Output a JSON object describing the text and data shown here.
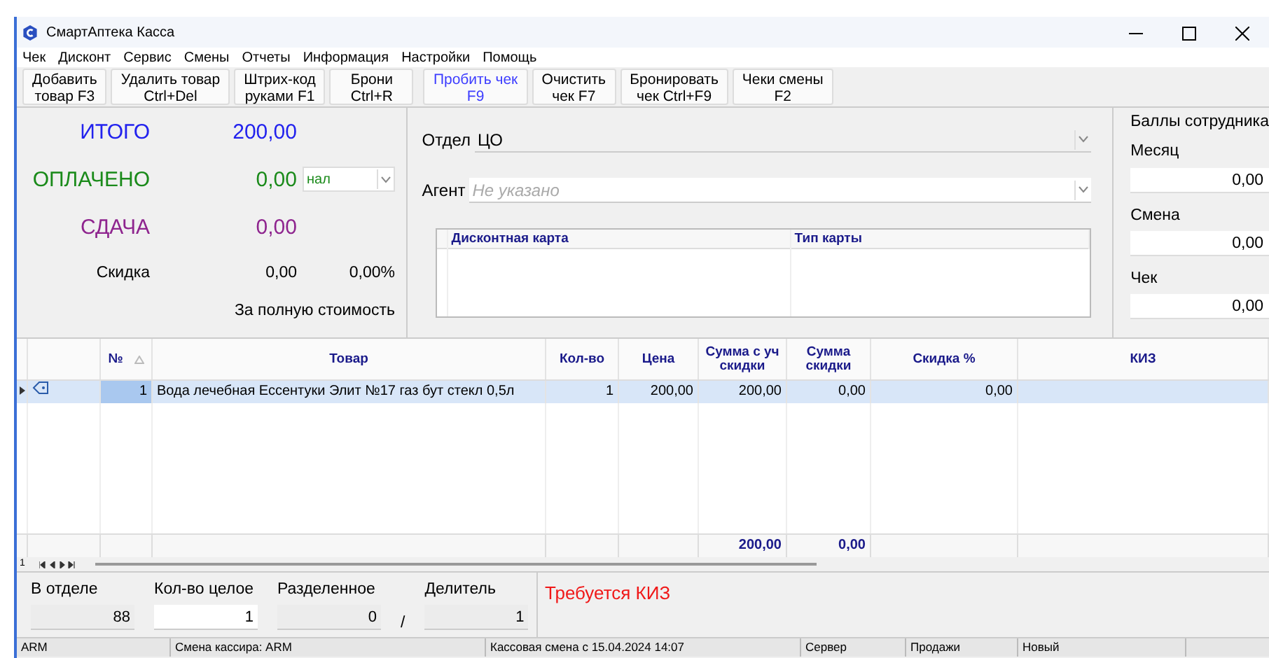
{
  "window": {
    "title": "СмартАптека Касса"
  },
  "menu": [
    "Чек",
    "Дисконт",
    "Сервис",
    "Смены",
    "Отчеты",
    "Информация",
    "Настройки",
    "Помощь"
  ],
  "toolbar": [
    {
      "lines": [
        "Добавить",
        "товар F3"
      ],
      "kind": "normal"
    },
    {
      "lines": [
        "Удалить товар",
        "Ctrl+Del"
      ],
      "kind": "normal"
    },
    {
      "lines": [
        "Штрих-код",
        "руками F1"
      ],
      "kind": "normal"
    },
    {
      "lines": [
        "Брони",
        "Ctrl+R"
      ],
      "kind": "normal"
    },
    {
      "lines": [
        "Пробить чек",
        "F9"
      ],
      "kind": "primary"
    },
    {
      "lines": [
        "Очистить",
        "чек F7"
      ],
      "kind": "normal"
    },
    {
      "lines": [
        "Бронировать",
        "чек Ctrl+F9"
      ],
      "kind": "normal"
    },
    {
      "lines": [
        "Чеки смены",
        "F2"
      ],
      "kind": "normal"
    }
  ],
  "summary": {
    "totals": [
      {
        "label": "ИТОГО",
        "value": "200,00",
        "kind": "total"
      },
      {
        "label": "ОПЛАЧЕНО",
        "value": "0,00",
        "kind": "paid",
        "payment": "нал"
      },
      {
        "label": "СДАЧА",
        "value": "0,00",
        "kind": "change"
      }
    ],
    "discount": {
      "label": "Скидка",
      "amount": "0,00",
      "percent": "0,00%"
    },
    "note": "За полную стоимость"
  },
  "department": {
    "label": "Отдел",
    "value": "ЦО"
  },
  "agent": {
    "label": "Агент",
    "placeholder": "Не указано"
  },
  "card_table": {
    "columns": [
      "Дисконтная карта",
      "Тип карты"
    ]
  },
  "employee_points": {
    "title": "Баллы сотрудника",
    "fields": [
      {
        "label": "Месяц",
        "value": "0,00"
      },
      {
        "label": "Смена",
        "value": "0,00"
      },
      {
        "label": "Чек",
        "value": "0,00"
      }
    ]
  },
  "items_table": {
    "columns": [
      {
        "label": "№",
        "sorted": true
      },
      {
        "label": "Товар",
        "sorted": false
      },
      {
        "label": "Кол-во",
        "sorted": false
      },
      {
        "label": "Цена",
        "sorted": false
      },
      {
        "label": "Сумма с уч скидки",
        "sorted": false
      },
      {
        "label": "Сумма скидки",
        "sorted": false
      },
      {
        "label": "Скидка %",
        "sorted": false
      },
      {
        "label": "КИЗ",
        "sorted": false
      }
    ],
    "rows": [
      {
        "selected": true,
        "cells": [
          "1",
          "Вода лечебная  Ессентуки Элит №17 газ бут стекл 0,5л",
          "1",
          "200,00",
          "200,00",
          "0,00",
          "0,00",
          ""
        ]
      }
    ],
    "totals": {
      "sum_with_discount": "200,00",
      "discount_sum": "0,00"
    }
  },
  "navigator": {
    "record": "1"
  },
  "quantity": {
    "fields": [
      {
        "label": "В отделе",
        "value": "88",
        "editable": false
      },
      {
        "label": "Кол-во целое",
        "value": "1",
        "editable": true
      },
      {
        "label": "Разделенное",
        "value": "0",
        "editable": false
      },
      {
        "label": "Делитель",
        "value": "1",
        "editable": false
      }
    ],
    "separator": "/"
  },
  "message": "Требуется КИЗ",
  "status_bar": [
    "ARM",
    "Смена кассира: ARM",
    "Кассовая смена с 15.04.2024 14:07",
    "Сервер",
    "Продажи",
    "Новый"
  ]
}
